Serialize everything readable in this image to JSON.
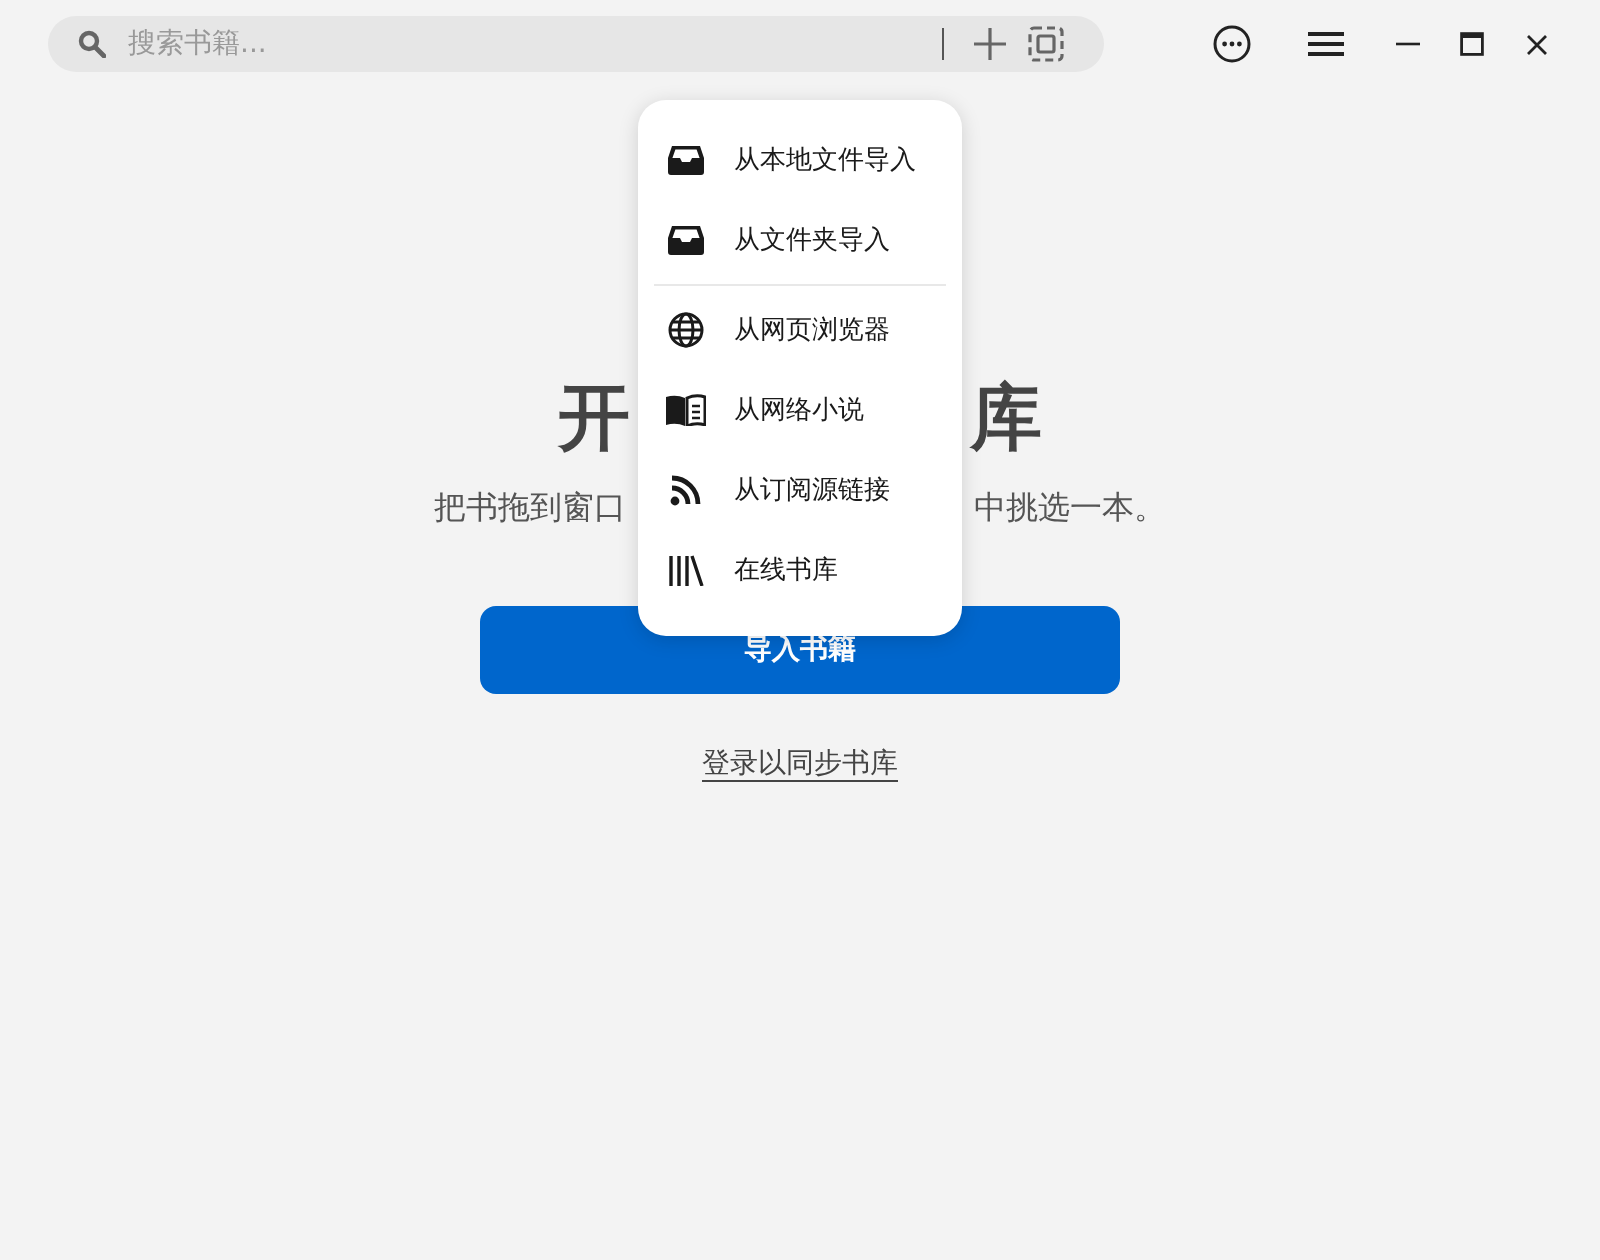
{
  "search": {
    "placeholder": "搜索书籍..."
  },
  "heading_parts": [
    "开",
    "库"
  ],
  "subtitle_parts": [
    "把书拖到窗口",
    "中挑选一本。"
  ],
  "import_button": "导入书籍",
  "login_link": "登录以同步书库",
  "import_menu": [
    {
      "kind": "tray",
      "label": "从本地文件导入"
    },
    {
      "kind": "tray",
      "label": "从文件夹导入"
    },
    {
      "kind": "divider"
    },
    {
      "kind": "globe",
      "label": "从网页浏览器"
    },
    {
      "kind": "book",
      "label": "从网络小说"
    },
    {
      "kind": "rss",
      "label": "从订阅源链接"
    },
    {
      "kind": "library",
      "label": "在线书库"
    }
  ]
}
